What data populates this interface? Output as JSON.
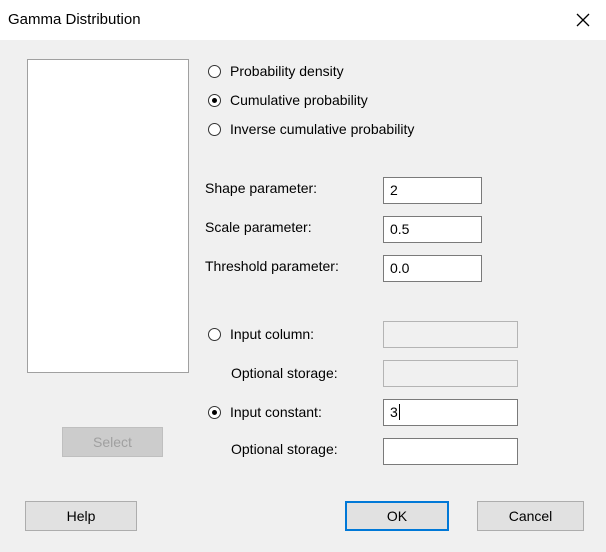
{
  "window": {
    "title": "Gamma Distribution"
  },
  "options": {
    "probability_density": "Probability density",
    "cumulative_probability": "Cumulative probability",
    "inverse_cumulative_probability": "Inverse cumulative probability",
    "selected": "cumulative_probability"
  },
  "params": {
    "shape_label": "Shape parameter:",
    "shape_value": "2",
    "scale_label": "Scale parameter:",
    "scale_value": "0.5",
    "threshold_label": "Threshold parameter:",
    "threshold_value": "0.0"
  },
  "input_column": {
    "label": "Input column:",
    "storage_label": "Optional storage:",
    "value": "",
    "storage_value": ""
  },
  "input_constant": {
    "label": "Input constant:",
    "value": "3",
    "storage_label": "Optional storage:",
    "storage_value": "",
    "selected": true
  },
  "buttons": {
    "select": "Select",
    "help": "Help",
    "ok": "OK",
    "cancel": "Cancel"
  },
  "icons": {
    "close": "close-icon"
  }
}
